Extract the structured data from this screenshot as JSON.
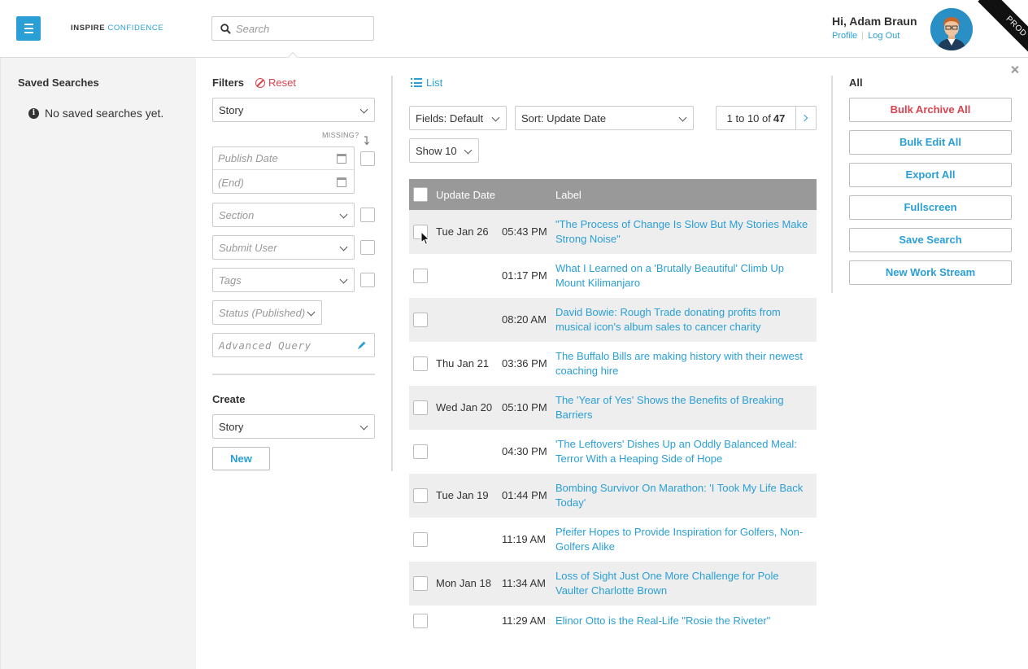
{
  "header": {
    "logo_bold": "INSPIRE",
    "logo_accent": "CONFIDENCE",
    "search_placeholder": "Search",
    "greeting": "Hi, Adam Braun",
    "profile_link": "Profile",
    "logout_link": "Log Out",
    "ribbon": "PROD"
  },
  "sidebar": {
    "title": "Saved Searches",
    "empty_message": "No saved searches yet."
  },
  "filters": {
    "title": "Filters",
    "reset_label": "Reset",
    "type_select": "Story",
    "missing_label": "MISSING?",
    "publish_date_placeholder": "Publish Date",
    "end_date_placeholder": "(End)",
    "section_placeholder": "Section",
    "submit_user_placeholder": "Submit User",
    "tags_placeholder": "Tags",
    "status_placeholder": "Status (Published)",
    "advanced_query_placeholder": "Advanced Query",
    "create_title": "Create",
    "create_select": "Story",
    "new_button": "New"
  },
  "main": {
    "view_label": "List",
    "fields_select": "Fields: Default",
    "sort_select": "Sort: Update Date",
    "show_select": "Show 10",
    "pager_range": "1 to 10 of",
    "pager_total": "47",
    "columns": {
      "update_date": "Update Date",
      "label": "Label"
    },
    "rows": [
      {
        "date": "Tue Jan 26",
        "time": "05:43 PM",
        "label": "\"The Process of Change Is Slow But My Stories Make Strong Noise\""
      },
      {
        "date": "",
        "time": "01:17 PM",
        "label": "What I Learned on a 'Brutally Beautiful' Climb Up Mount Kilimanjaro"
      },
      {
        "date": "",
        "time": "08:20 AM",
        "label": "David Bowie: Rough Trade donating profits from musical icon's album sales to cancer charity"
      },
      {
        "date": "Thu Jan 21",
        "time": "03:36 PM",
        "label": "The Buffalo Bills are making history with their newest coaching hire"
      },
      {
        "date": "Wed Jan 20",
        "time": "05:10 PM",
        "label": "The 'Year of Yes' Shows the Benefits of Breaking Barriers"
      },
      {
        "date": "",
        "time": "04:30 PM",
        "label": "'The Leftovers' Dishes Up an Oddly Balanced Meal: Terror With a Heaping Side of Hope"
      },
      {
        "date": "Tue Jan 19",
        "time": "01:44 PM",
        "label": "Bombing Survivor On Marathon: 'I Took My Life Back Today'"
      },
      {
        "date": "",
        "time": "11:19 AM",
        "label": "Pfeifer Hopes to Provide Inspiration for Golfers, Non-Golfers Alike"
      },
      {
        "date": "Mon Jan 18",
        "time": "11:34 AM",
        "label": "Loss of Sight Just One More Challenge for Pole Vaulter Charlotte Brown"
      },
      {
        "date": "",
        "time": "11:29 AM",
        "label": "Elinor Otto is the Real-Life \"Rosie the Riveter\""
      }
    ]
  },
  "actions": {
    "title": "All",
    "bulk_archive": "Bulk Archive All",
    "bulk_edit": "Bulk Edit All",
    "export_all": "Export All",
    "fullscreen": "Fullscreen",
    "save_search": "Save Search",
    "new_work_stream": "New Work Stream"
  },
  "colors": {
    "accent": "#2a9fd6",
    "danger": "#d9434e",
    "table_header": "#999999"
  }
}
